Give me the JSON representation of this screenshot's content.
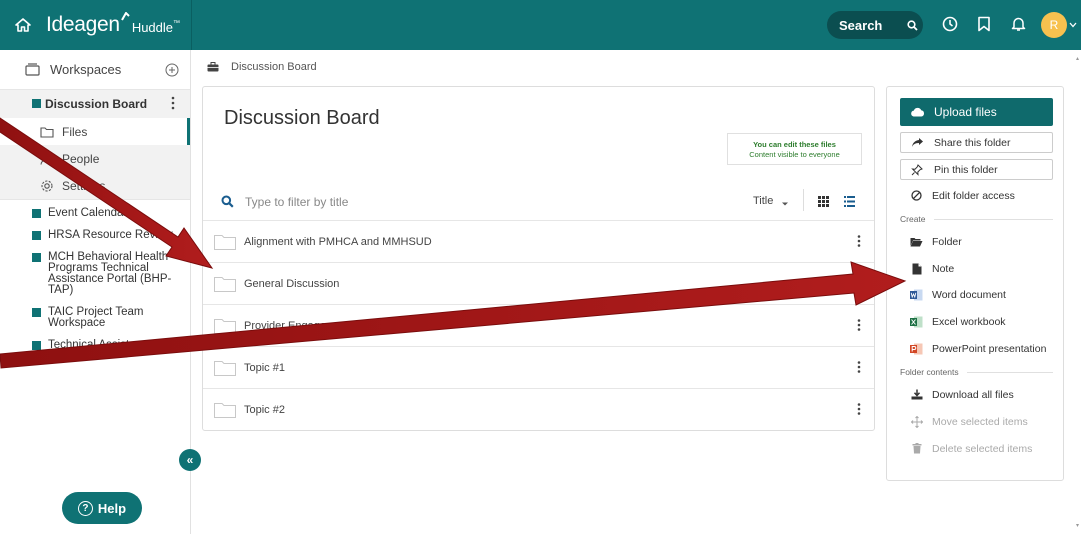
{
  "header": {
    "brand_main": "Ideagen",
    "brand_sub": "Huddle",
    "brand_tm": "™",
    "search_label": "Search",
    "avatar_initial": "R",
    "accent_color": "#0f7274",
    "avatar_color": "#f7c14f",
    "icons": [
      "home-icon",
      "search-icon",
      "clock-icon",
      "bookmark-icon",
      "bell-icon",
      "chevron-down-icon"
    ]
  },
  "sidebar": {
    "workspaces_label": "Workspaces",
    "current_workspace": "Discussion Board",
    "sub_items": [
      {
        "label": "Files",
        "icon": "folder-icon"
      },
      {
        "label": "People",
        "icon": "people-icon"
      },
      {
        "label": "Settings",
        "icon": "gear-icon"
      }
    ],
    "workspaces": [
      "Event Calendar",
      "HRSA Resource Review",
      "MCH Behavioral Health Programs Technical Assistance Portal (BHP-TAP)",
      "TAIC Project Team Workspace",
      "Technical Assistance (TA) Requests"
    ],
    "help_label": "Help",
    "collapse_label": "«"
  },
  "breadcrumb": {
    "label": "Discussion Board"
  },
  "main": {
    "title": "Discussion Board",
    "edit_note_line1": "You can edit these files",
    "edit_note_line2": "Content visible to everyone",
    "filter_placeholder": "Type to filter by title",
    "sort_label": "Title",
    "folders": [
      "Alignment with PMHCA and MMHSUD",
      "General Discussion",
      "Provider Engagement",
      "Topic #1",
      "Topic #2"
    ]
  },
  "actions": {
    "upload": "Upload files",
    "share": "Share this folder",
    "pin": "Pin this folder",
    "edit_access": "Edit folder access",
    "create_label": "Create",
    "folder": "Folder",
    "note": "Note",
    "word": "Word document",
    "excel": "Excel workbook",
    "powerpoint": "PowerPoint presentation",
    "contents_label": "Folder contents",
    "download_all": "Download all files",
    "move_selected": "Move selected items",
    "delete_selected": "Delete selected items"
  }
}
